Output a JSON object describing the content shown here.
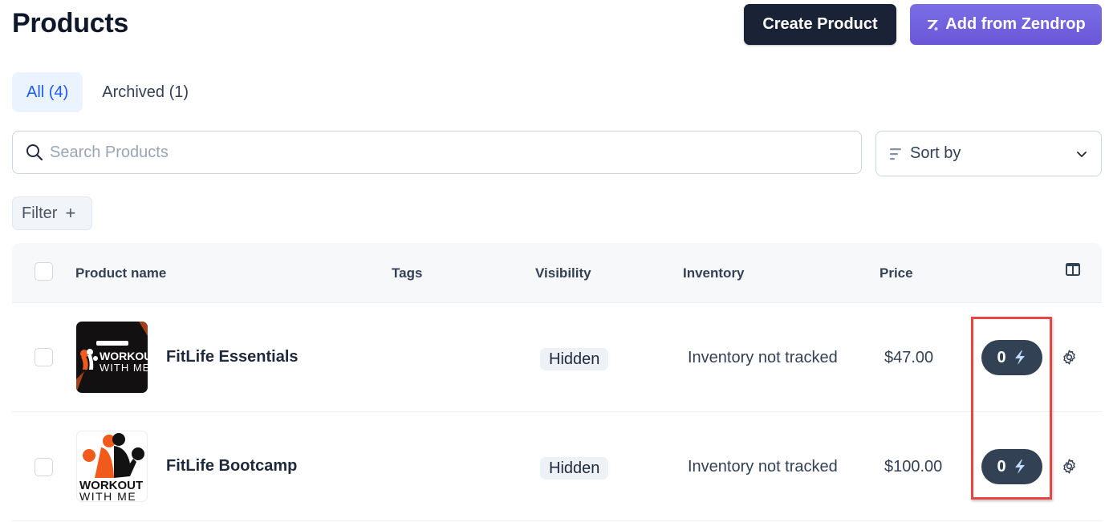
{
  "header": {
    "title": "Products",
    "create_button": "Create Product",
    "zendrop_button": "Add from Zendrop"
  },
  "tabs": [
    {
      "label": "All (4)",
      "active": true
    },
    {
      "label": "Archived (1)",
      "active": false
    }
  ],
  "search": {
    "placeholder": "Search Products",
    "value": ""
  },
  "sort": {
    "label": "Sort by"
  },
  "filter": {
    "label": "Filter",
    "icon": "plus-icon"
  },
  "table": {
    "columns": [
      "Product name",
      "Tags",
      "Visibility",
      "Inventory",
      "Price"
    ],
    "rows": [
      {
        "name": "FitLife Essentials",
        "tags": "",
        "visibility": "Hidden",
        "inventory": "Inventory not tracked",
        "price": "$47.00",
        "boost_count": "0",
        "thumbnail": {
          "line1": "WORKOUT",
          "line2": "WITH ME",
          "theme": "dark"
        }
      },
      {
        "name": "FitLife Bootcamp",
        "tags": "",
        "visibility": "Hidden",
        "inventory": "Inventory not tracked",
        "price": "$100.00",
        "boost_count": "0",
        "thumbnail": {
          "line1": "WORKOUT",
          "line2": "WITH ME",
          "theme": "light"
        }
      }
    ]
  },
  "colors": {
    "primary_dark": "#1a2336",
    "zendrop_purple": "#6f5ddd",
    "active_tab_bg": "#eaf3ff",
    "active_tab_text": "#1d5cf0",
    "boost_bg": "#334155",
    "bolt": "#bfdbfe",
    "highlight": "#e84545",
    "brand_orange": "#f05a1a"
  }
}
